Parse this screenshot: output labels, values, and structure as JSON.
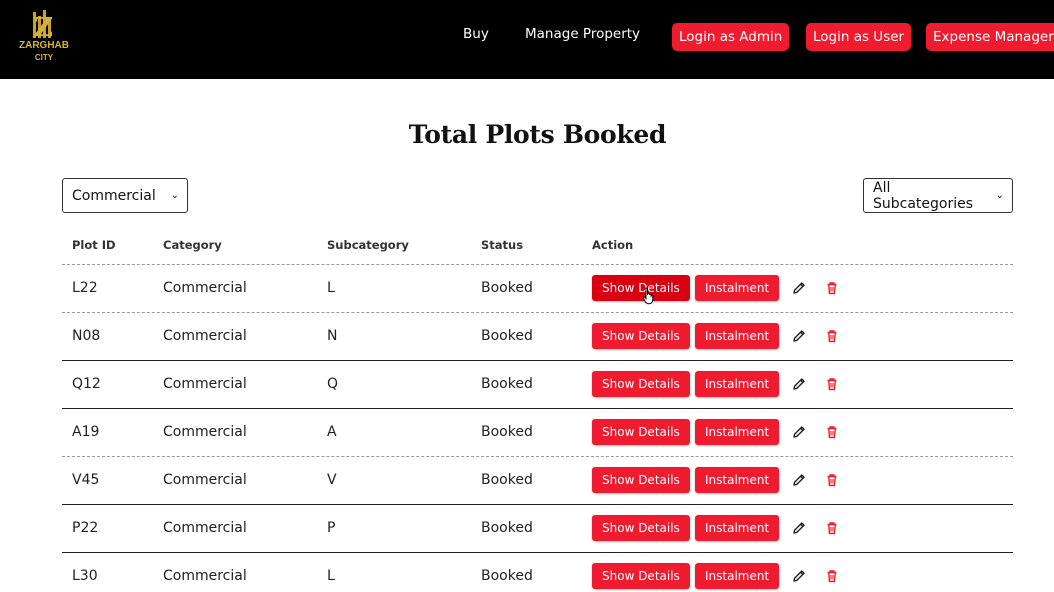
{
  "brand": {
    "name": "ZARGHAB",
    "sub": "CITY",
    "logo_letter": "Z",
    "gold": "#c9a227"
  },
  "nav": {
    "links": [
      "Buy",
      "Manage Property"
    ],
    "buttons": [
      "Login as Admin",
      "Login as User",
      "Expense Manager"
    ]
  },
  "page": {
    "title": "Total Plots Booked"
  },
  "filters": {
    "category": "Commercial",
    "subcategory": "All Subcategories"
  },
  "table": {
    "headers": [
      "Plot ID",
      "Category",
      "Subcategory",
      "Status",
      "Action"
    ],
    "rows": [
      {
        "id": "L22",
        "category": "Commercial",
        "subcategory": "L",
        "status": "Booked"
      },
      {
        "id": "N08",
        "category": "Commercial",
        "subcategory": "N",
        "status": "Booked"
      },
      {
        "id": "Q12",
        "category": "Commercial",
        "subcategory": "Q",
        "status": "Booked"
      },
      {
        "id": "A19",
        "category": "Commercial",
        "subcategory": "A",
        "status": "Booked"
      },
      {
        "id": "V45",
        "category": "Commercial",
        "subcategory": "V",
        "status": "Booked"
      },
      {
        "id": "P22",
        "category": "Commercial",
        "subcategory": "P",
        "status": "Booked"
      },
      {
        "id": "L30",
        "category": "Commercial",
        "subcategory": "L",
        "status": "Booked"
      }
    ],
    "actions": {
      "details": "Show Details",
      "instalment": "Instalment"
    }
  },
  "colors": {
    "accent": "#ee1c2e",
    "accent_active": "#d90012",
    "navbar": "#000000"
  }
}
